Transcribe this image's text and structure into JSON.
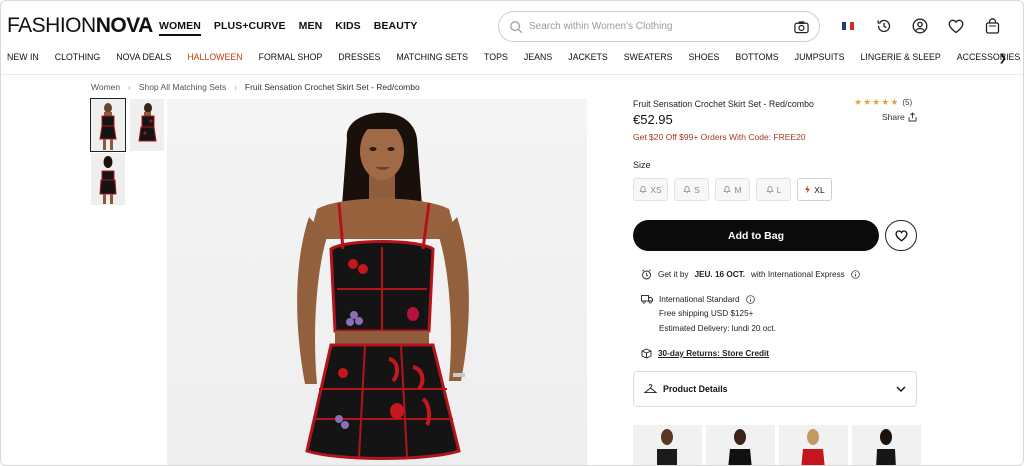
{
  "brand": {
    "logo_part1": "FASHION",
    "logo_part2": "NOVA"
  },
  "gender_nav": [
    "WOMEN",
    "PLUS+CURVE",
    "MEN",
    "KIDS",
    "BEAUTY"
  ],
  "search": {
    "placeholder": "Search within Women's Clothing"
  },
  "header_icons": [
    "camera-icon",
    "flag-icon",
    "history-icon",
    "account-icon",
    "heart-icon",
    "bag-icon"
  ],
  "categories": [
    "NEW IN",
    "CLOTHING",
    "NOVA DEALS",
    "HALLOWEEN",
    "FORMAL SHOP",
    "DRESSES",
    "MATCHING SETS",
    "TOPS",
    "JEANS",
    "JACKETS",
    "SWEATERS",
    "SHOES",
    "BOTTOMS",
    "JUMPSUITS",
    "LINGERIE & SLEEP",
    "ACCESSORIES"
  ],
  "breadcrumb": [
    "Women",
    "Shop All Matching Sets",
    "Fruit Sensation Crochet Skirt Set - Red/combo"
  ],
  "product": {
    "title": "Fruit Sensation Crochet Skirt Set - Red/combo",
    "rating_stars": 5,
    "review_count": "(5)",
    "share_label": "Share",
    "price": "€52.95",
    "promo": "Get $20 Off $99+ Orders With Code: FREE20",
    "size_label": "Size",
    "sizes": [
      {
        "label": "XS",
        "available": false
      },
      {
        "label": "S",
        "available": false
      },
      {
        "label": "M",
        "available": false
      },
      {
        "label": "L",
        "available": false
      },
      {
        "label": "XL",
        "available": true
      }
    ],
    "add_to_bag": "Add to Bag"
  },
  "shipping": {
    "get_it_prefix": "Get it by",
    "get_it_date": "JEU. 16 OCT.",
    "get_it_suffix": "with International Express",
    "intl_standard": "International Standard",
    "free_shipping": "Free shipping USD $125+",
    "estimated": "Estimated Delivery: lundi 20 oct.",
    "returns": "30-day Returns: Store Credit"
  },
  "product_details_label": "Product Details",
  "colors": {
    "accent_orange": "#c2410c",
    "promo_red": "#a23b1e",
    "star": "#e6a23c",
    "dress_black": "#141414",
    "dress_red": "#b3141c"
  }
}
